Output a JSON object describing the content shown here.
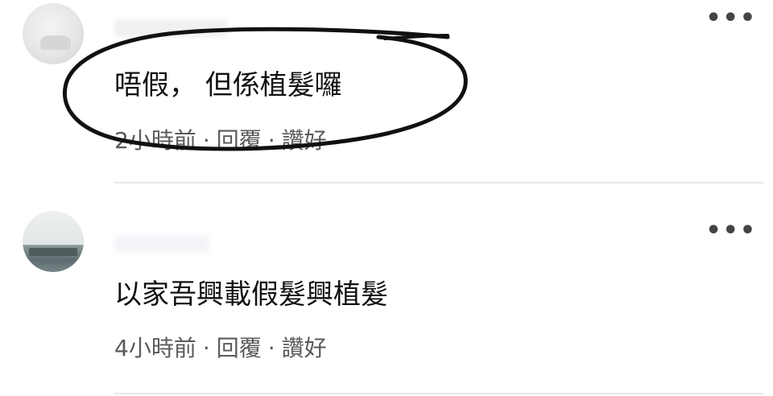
{
  "comments": [
    {
      "text": "唔假， 但係植髮囉",
      "time": "2小時前",
      "reply_label": "回覆",
      "like_label": "讚好",
      "separator": "·",
      "more_icon": "more-horizontal-icon"
    },
    {
      "text": "以家吾興載假髮興植髮",
      "time": "4小時前",
      "reply_label": "回覆",
      "like_label": "讚好",
      "separator": "·",
      "more_icon": "more-horizontal-icon"
    }
  ],
  "annotation": {
    "color": "#111111"
  },
  "colors": {
    "text": "#111111",
    "meta": "#5a5a5a",
    "divider": "#e8e8e8"
  }
}
